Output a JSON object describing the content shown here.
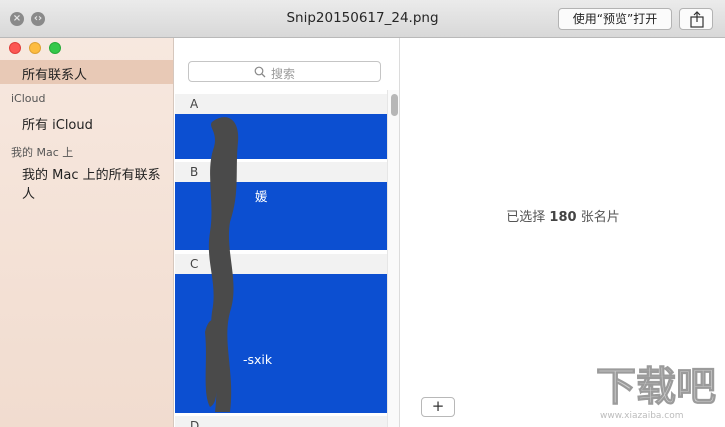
{
  "quicklook": {
    "title": "Snip20150617_24.png",
    "open_with_label": "使用“预览”打开",
    "close_icon": "close-icon",
    "fullscreen_icon": "fullscreen-icon",
    "share_icon": "share-icon"
  },
  "sidebar": {
    "all_contacts": "所有联系人",
    "icloud_header": "iCloud",
    "all_icloud": "所有 iCloud",
    "mac_header": "我的 Mac 上",
    "all_on_mac": "我的 Mac 上的所有联系人"
  },
  "list": {
    "search_placeholder": "搜索",
    "sections": [
      "A",
      "B",
      "C",
      "D"
    ],
    "visible_names": [
      "媛",
      "-sxik"
    ]
  },
  "detail": {
    "prefix": "已选择",
    "count": "180",
    "suffix": "张名片",
    "add_label": "+"
  },
  "colors": {
    "selection_blue": "#0c4fd1",
    "sidebar_bg": "#f4e1d5",
    "sidebar_selected": "#e8c9b6"
  },
  "watermark": {
    "text": "下载吧",
    "domain": "www.xiazaiba.com"
  }
}
